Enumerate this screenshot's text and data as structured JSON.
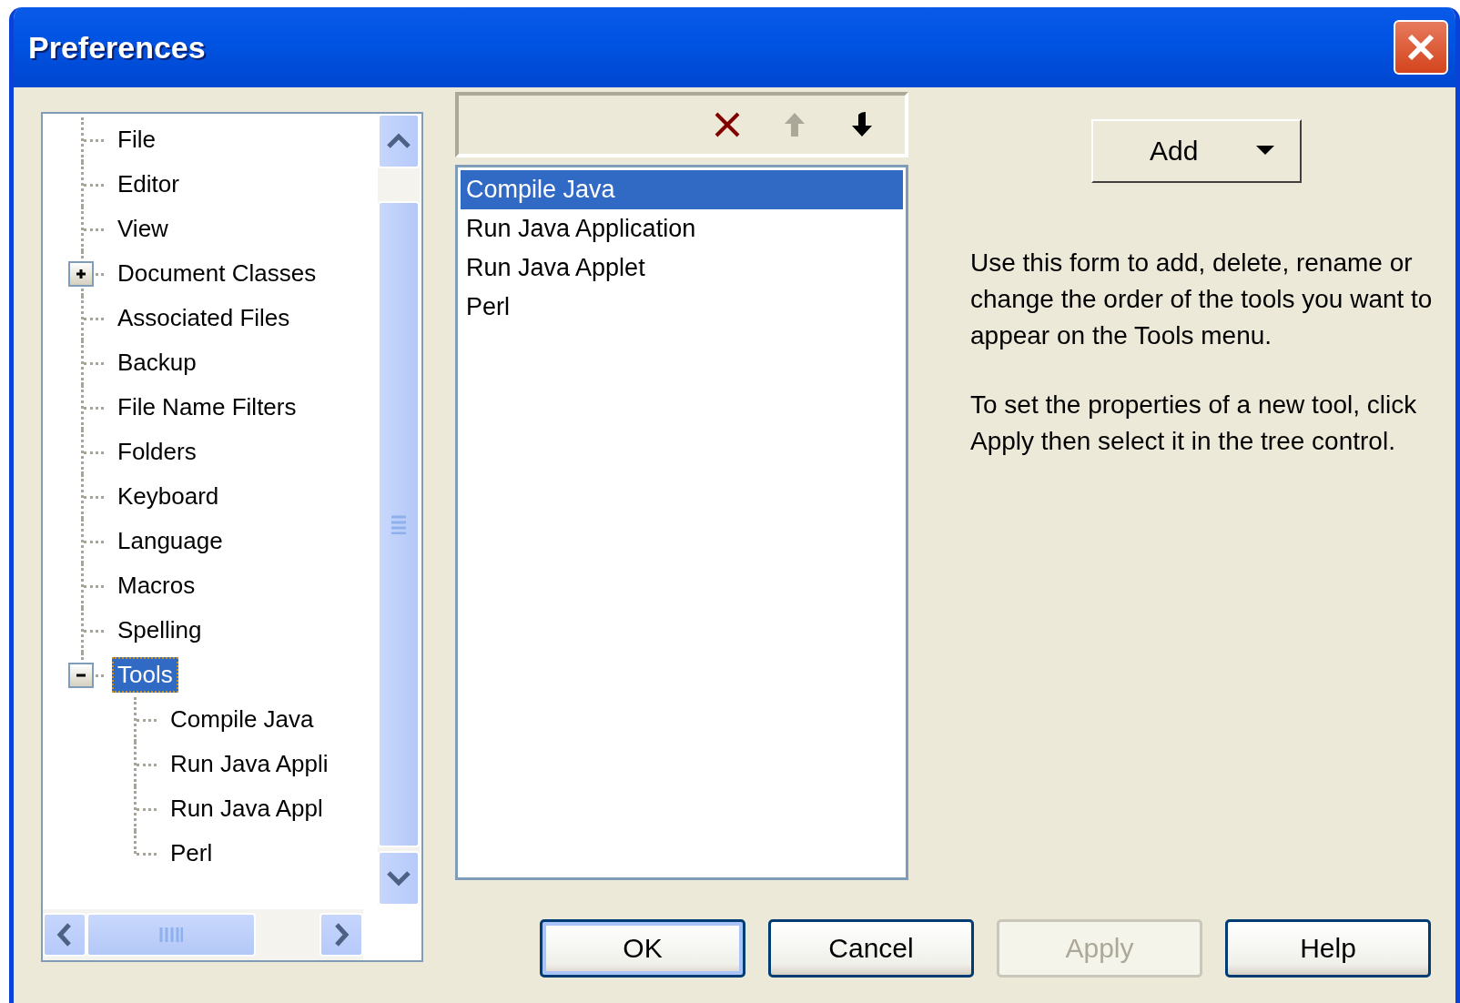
{
  "window": {
    "title": "Preferences"
  },
  "tree": {
    "items": [
      {
        "label": "File",
        "selected": false
      },
      {
        "label": "Editor",
        "selected": false
      },
      {
        "label": "View",
        "selected": false
      },
      {
        "label": "Document Classes",
        "selected": false,
        "expanded": false
      },
      {
        "label": "Associated Files",
        "selected": false
      },
      {
        "label": "Backup",
        "selected": false
      },
      {
        "label": "File Name Filters",
        "selected": false
      },
      {
        "label": "Folders",
        "selected": false
      },
      {
        "label": "Keyboard",
        "selected": false
      },
      {
        "label": "Language",
        "selected": false
      },
      {
        "label": "Macros",
        "selected": false
      },
      {
        "label": "Spelling",
        "selected": false
      },
      {
        "label": "Tools",
        "selected": true,
        "expanded": true,
        "children": [
          {
            "label": "Compile Java",
            "selected": false
          },
          {
            "label": "Run Java Appli",
            "selected": false
          },
          {
            "label": "Run Java Appl",
            "selected": false
          },
          {
            "label": "Perl",
            "selected": false
          }
        ]
      }
    ]
  },
  "toolbar": [
    {
      "kind": "delete",
      "disabled": false
    },
    {
      "kind": "up",
      "disabled": true
    },
    {
      "kind": "down",
      "disabled": false
    }
  ],
  "tools_list": [
    {
      "label": "Compile Java",
      "selected": true
    },
    {
      "label": "Run Java Application",
      "selected": false
    },
    {
      "label": "Run Java Applet",
      "selected": false
    },
    {
      "label": "Perl",
      "selected": false
    }
  ],
  "add_button": {
    "label": "Add"
  },
  "description": [
    "Use this form to add, delete, rename or change the order of the tools you want to appear on the Tools menu.",
    "To set the properties of a new tool, click Apply then select it in the tree control."
  ],
  "buttons": [
    {
      "label": "OK",
      "default": true,
      "disabled": false
    },
    {
      "label": "Cancel",
      "default": false,
      "disabled": false
    },
    {
      "label": "Apply",
      "default": false,
      "disabled": true
    },
    {
      "label": "Help",
      "default": false,
      "disabled": false
    }
  ]
}
